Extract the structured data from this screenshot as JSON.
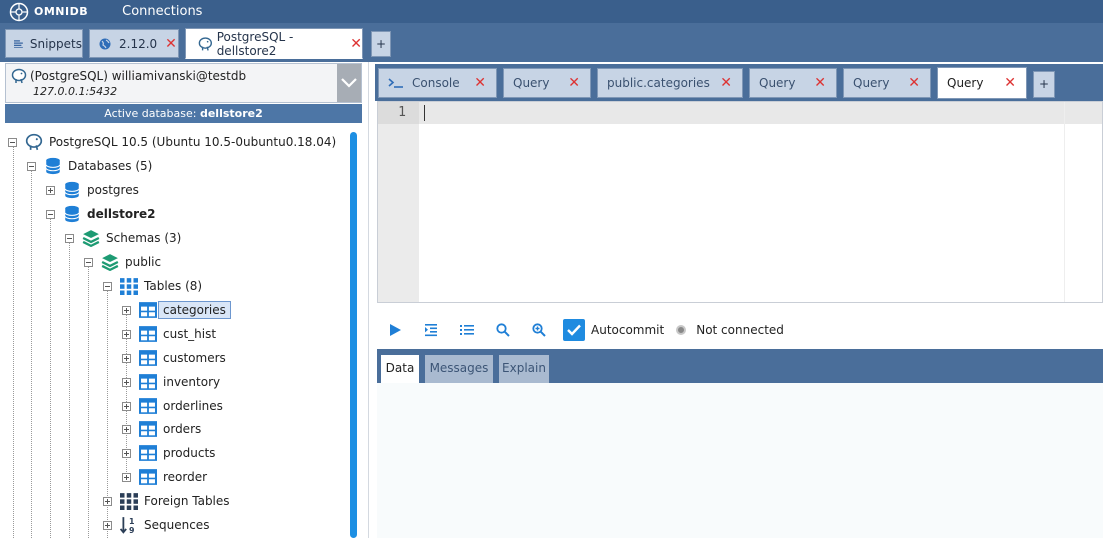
{
  "app": {
    "brand": "OMNIDB",
    "nav_connections": "Connections"
  },
  "outer_tabs": [
    {
      "label": "Snippets",
      "icon": "snippets-icon",
      "closable": false
    },
    {
      "label": "2.12.0",
      "icon": "globe-icon",
      "closable": true
    },
    {
      "label": "PostgreSQL - dellstore2",
      "icon": "postgresql-elephant-icon",
      "closable": true,
      "active": true
    }
  ],
  "outer_add_label": "+",
  "connection": {
    "title": "(PostgreSQL) williamivanski@testdb",
    "host": "127.0.0.1:5432",
    "active_db_prefix": "Active database:",
    "active_db_name": "dellstore2"
  },
  "tree": {
    "server": "PostgreSQL 10.5 (Ubuntu 10.5-0ubuntu0.18.04)",
    "databases": "Databases (5)",
    "db_postgres": "postgres",
    "db_dellstore2": "dellstore2",
    "schemas": "Schemas (3)",
    "schema_public": "public",
    "tables": "Tables (8)",
    "table_names": [
      "categories",
      "cust_hist",
      "customers",
      "inventory",
      "orderlines",
      "orders",
      "products",
      "reorder"
    ],
    "foreign_tables": "Foreign Tables",
    "sequences": "Sequences"
  },
  "inner_tabs": [
    {
      "label": "Console",
      "icon": "console-icon"
    },
    {
      "label": "Query"
    },
    {
      "label": "public.categories"
    },
    {
      "label": "Query"
    },
    {
      "label": "Query"
    },
    {
      "label": "Query",
      "active": true
    }
  ],
  "inner_add_label": "+",
  "editor": {
    "line_number": "1"
  },
  "toolbar": {
    "autocommit_label": "Autocommit",
    "status_text": "Not connected"
  },
  "result_tabs": [
    "Data",
    "Messages",
    "Explain"
  ],
  "colors": {
    "topbar": "#3a5f8c",
    "tab_strip": "#4a6e9a",
    "accent_blue": "#1f8be0",
    "close_red": "#d33333",
    "schema_green": "#1e9b73"
  }
}
